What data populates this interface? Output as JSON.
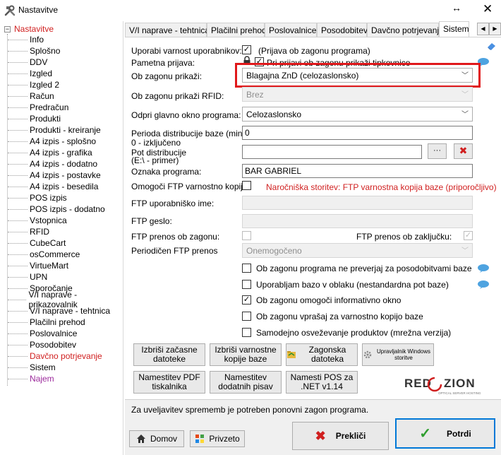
{
  "window": {
    "title": "Nastavitve",
    "resize_glyph": "↔",
    "close_glyph": "✕"
  },
  "tree": {
    "root": "Nastavitve",
    "root_expander": "−",
    "items": [
      {
        "label": "Info",
        "style": "normal"
      },
      {
        "label": "Splošno",
        "style": "normal"
      },
      {
        "label": "DDV",
        "style": "normal"
      },
      {
        "label": "Izgled",
        "style": "normal"
      },
      {
        "label": "Izgled 2",
        "style": "normal"
      },
      {
        "label": "Račun",
        "style": "normal"
      },
      {
        "label": "Predračun",
        "style": "normal"
      },
      {
        "label": "Produkti",
        "style": "normal"
      },
      {
        "label": "Produkti - kreiranje",
        "style": "normal"
      },
      {
        "label": "A4 izpis - splošno",
        "style": "normal"
      },
      {
        "label": "A4 izpis - grafika",
        "style": "normal"
      },
      {
        "label": "A4 izpis - dodatno",
        "style": "normal"
      },
      {
        "label": "A4 izpis - postavke",
        "style": "normal"
      },
      {
        "label": "A4 izpis - besedila",
        "style": "normal"
      },
      {
        "label": "POS izpis",
        "style": "normal"
      },
      {
        "label": "POS izpis - dodatno",
        "style": "normal"
      },
      {
        "label": "Vstopnica",
        "style": "normal"
      },
      {
        "label": "RFID",
        "style": "normal"
      },
      {
        "label": "CubeCart",
        "style": "normal"
      },
      {
        "label": "osCommerce",
        "style": "normal"
      },
      {
        "label": "VirtueMart",
        "style": "normal"
      },
      {
        "label": "UPN",
        "style": "normal"
      },
      {
        "label": "Sporočanje",
        "style": "normal"
      },
      {
        "label": "V/I naprave - prikazovalnik",
        "style": "normal"
      },
      {
        "label": "V/I naprave - tehtnica",
        "style": "normal"
      },
      {
        "label": "Plačilni prehod",
        "style": "normal"
      },
      {
        "label": "Poslovalnice",
        "style": "normal"
      },
      {
        "label": "Posodobitev",
        "style": "normal"
      },
      {
        "label": "Davčno potrjevanje",
        "style": "red"
      },
      {
        "label": "Sistem",
        "style": "normal"
      },
      {
        "label": "Najem",
        "style": "purple"
      }
    ]
  },
  "tabs": [
    {
      "label": "V/I naprave - tehtnica",
      "active": false
    },
    {
      "label": "Plačilni prehod",
      "active": false
    },
    {
      "label": "Poslovalnice",
      "active": false
    },
    {
      "label": "Posodobitev",
      "active": false
    },
    {
      "label": "Davčno potrjevanje",
      "active": false
    },
    {
      "label": "Sistem",
      "active": true
    }
  ],
  "tab_nav": {
    "prev": "◀",
    "next": "▶"
  },
  "form": {
    "use_login_label": "Uporabi varnost uporabnikov:",
    "use_login_checked": "✓",
    "use_login_note": "(Prijava ob zagonu programa)",
    "remember_login_label": "Pametna prijava:",
    "remember_login_checked": "✓",
    "remember_login_note": "Pri prijavi ob zagonu prikaži tipkovnico",
    "startup_show_label": "Ob zagonu prikaži:",
    "startup_show_value": "Blagajna ZnD (celozaslonsko)",
    "startup_rfid_label": "Ob zagonu prikaži RFID:",
    "startup_rfid_value": "Brez",
    "main_window_label": "Odpri glavno okno programa:",
    "main_window_value": "Celozaslonsko",
    "distribution_period_label": "Perioda distribucije baze (min)",
    "distribution_period_hint": "0 - izključeno",
    "distribution_period_value": "0",
    "distribution_path_label": "Pot distribucije",
    "distribution_path_hint": "(E:\\ - primer)",
    "distribution_path_value": "",
    "browse_label": "···",
    "delete_glyph": "✖",
    "program_tag_label": "Oznaka programa:",
    "program_tag_value": "BAR GABRIEL",
    "ftp_backup_label": "Omogoči FTP varnostno kopijo:",
    "ftp_backup_note": "Naročniška storitev: FTP varnostna kopija baze (priporočljivo)",
    "ftp_user_label": "FTP uporabniško ime:",
    "ftp_user_value": "",
    "ftp_pass_label": "FTP geslo:",
    "ftp_pass_value": "",
    "ftp_on_start_label": "FTP prenos ob zagonu:",
    "ftp_on_end_label": "FTP prenos ob zaključku:",
    "ftp_on_end_checked": "✓",
    "ftp_periodic_label": "Periodičen FTP prenos",
    "ftp_periodic_value": "Onemogočeno",
    "option1": "Ob zagonu programa ne preverjaj za posodobitvami baze",
    "option2": "Uporabljam bazo v oblaku (nestandardna pot baze)",
    "option3": "Ob zagonu omogoči informativno okno",
    "option3_checked": "✓",
    "option4": "Ob zagonu vprašaj za varnostno kopijo baze",
    "option5": "Samodejno osveževanje produktov (mrežna verzija)"
  },
  "buttons": {
    "delete_temp": "Izbriši začasne datoteke",
    "delete_backups": "Izbriši varnostne kopije baze",
    "startup_file": "Zagonska datoteka",
    "win_service": "Upravljalnik Windows storitve",
    "install_pdf": "Namestitev PDF tiskalnika",
    "install_font": "Namestitev dodatnih pisav",
    "install_pos": "Namesti POS za .NET v1.14"
  },
  "logo": {
    "text": "RED ZION",
    "sub": "OPTICAL SERVER HOSTING"
  },
  "status": {
    "restart_note": "Za uveljavitev sprememb je potreben ponovni zagon programa.",
    "home": "Domov",
    "refresh": "Privzeto",
    "cancel": "Prekliči",
    "confirm": "Potrdi"
  },
  "colors": {
    "red": "#d01f1f",
    "highlight": "#e0181b",
    "accent": "#0078d7",
    "info_bubble": "#4ea3e0"
  }
}
